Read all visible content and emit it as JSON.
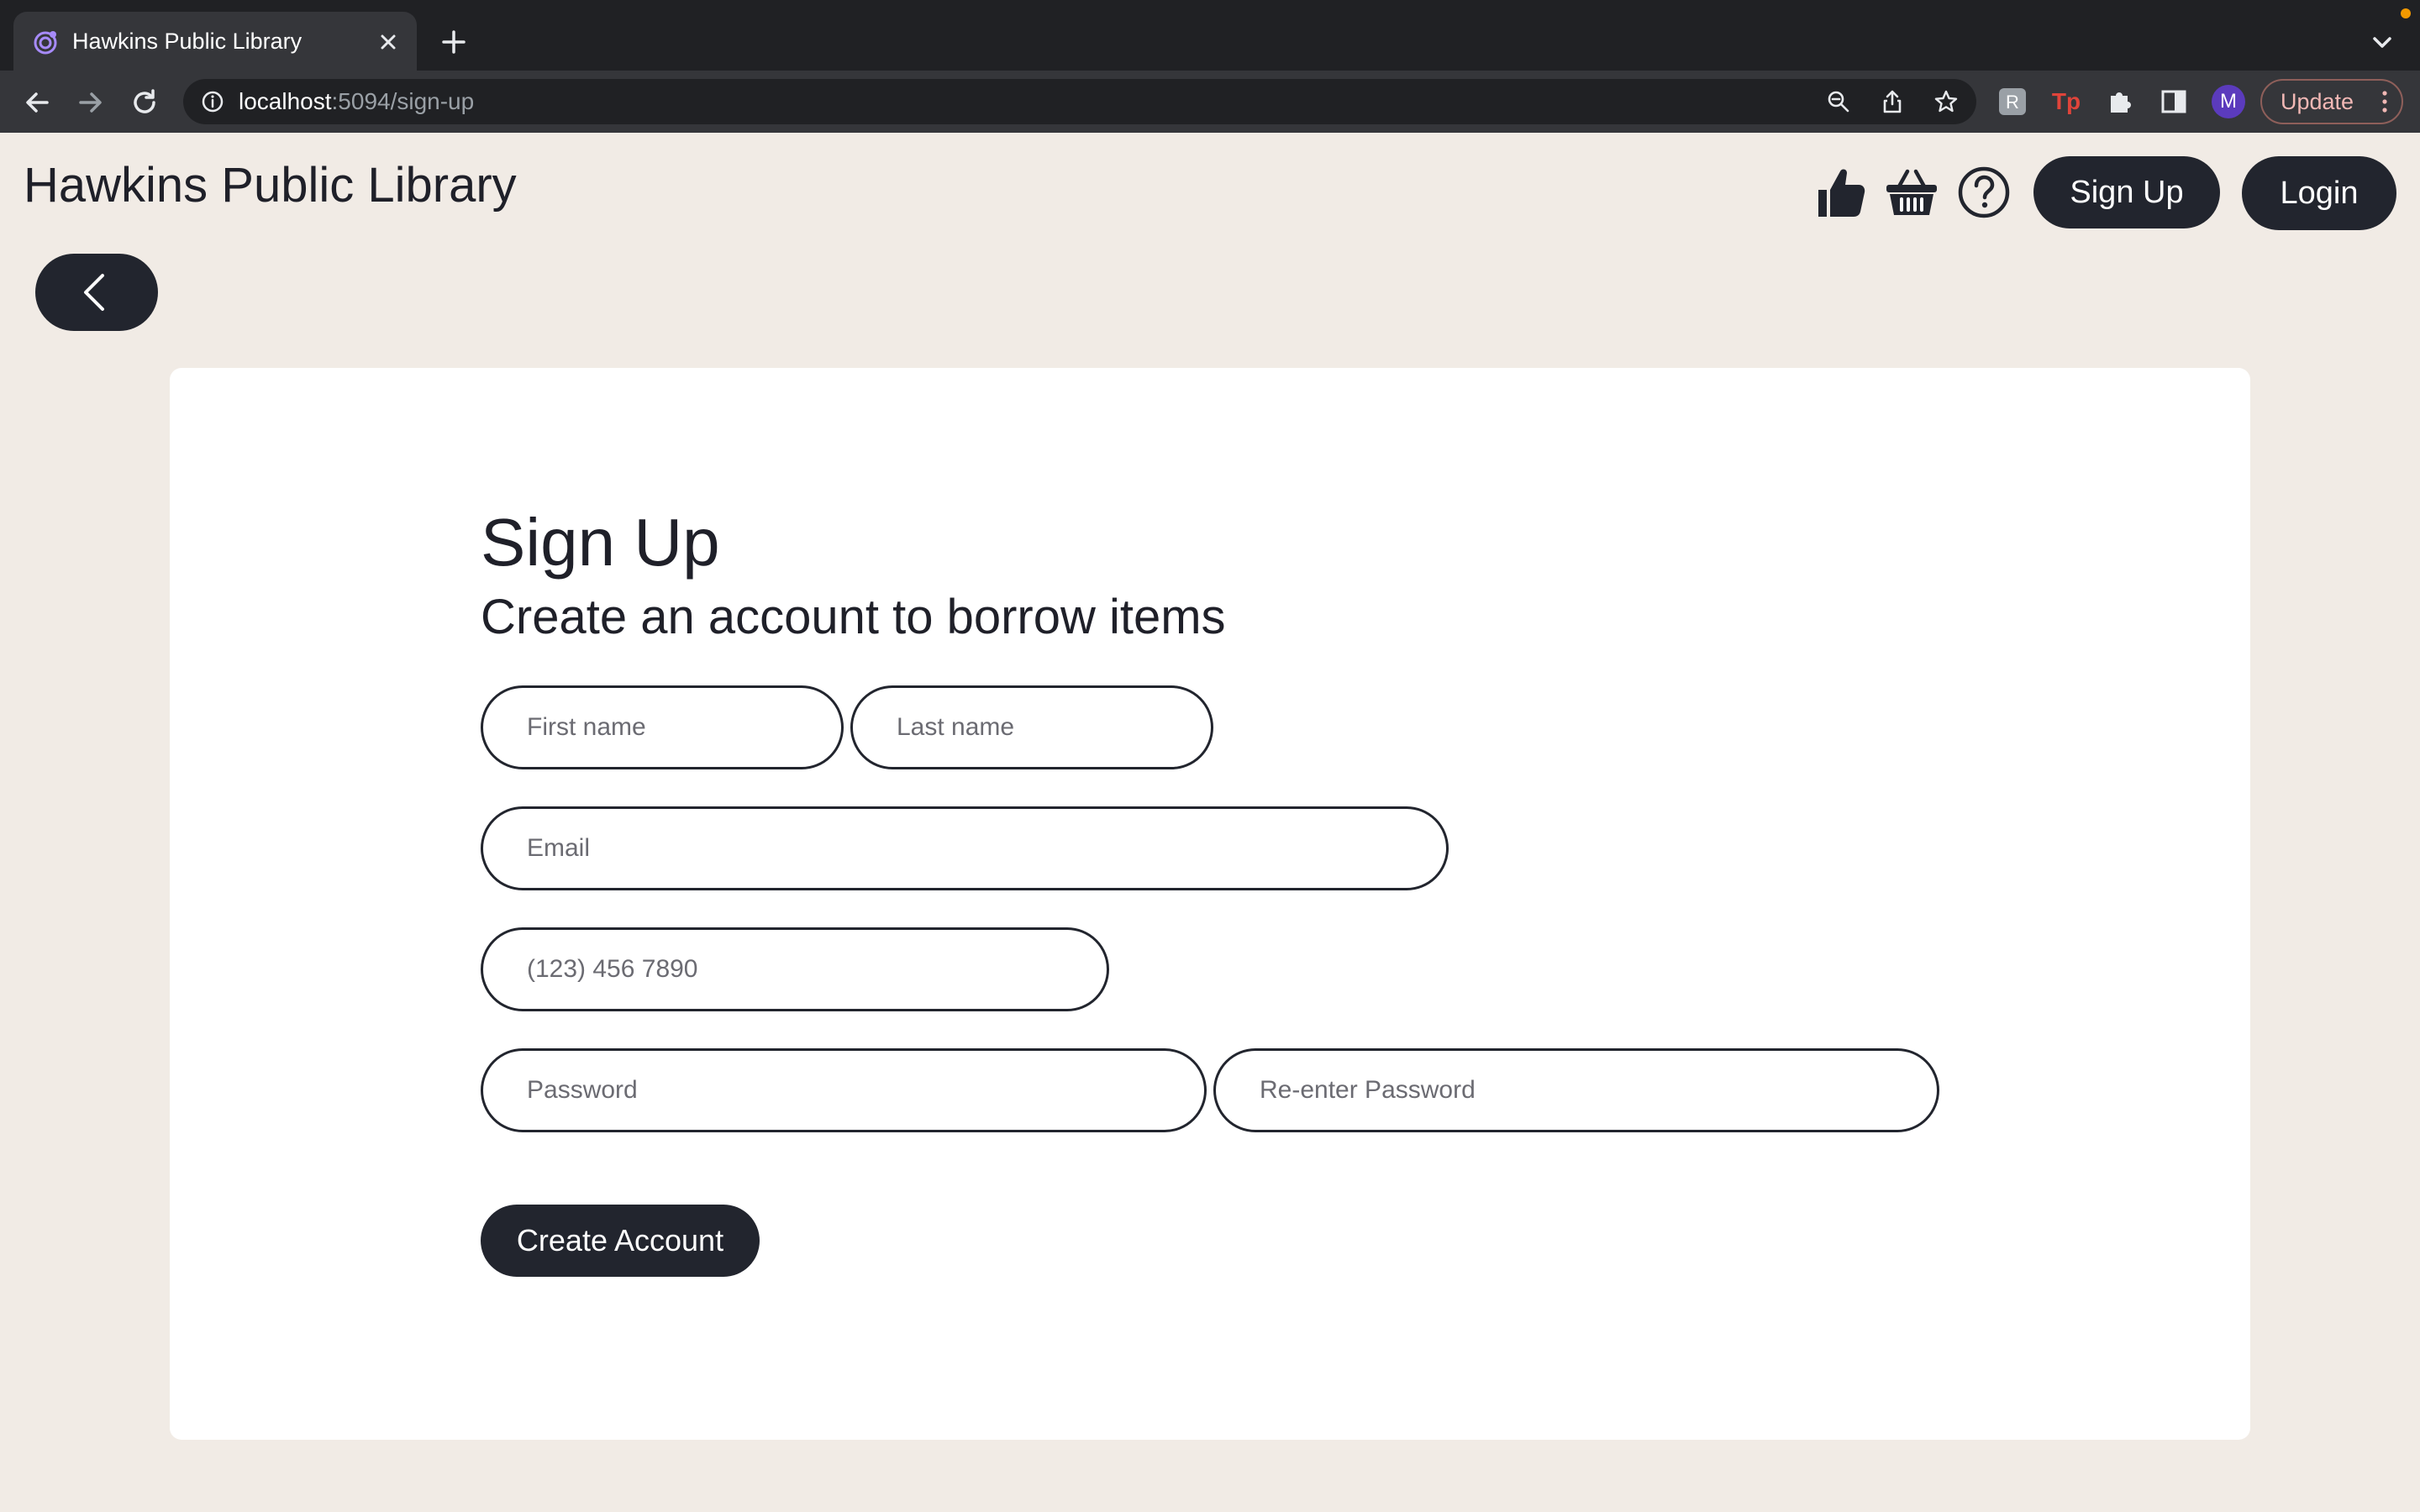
{
  "browser": {
    "tab_title": "Hawkins Public Library",
    "url_host": "localhost",
    "url_rest": ":5094/sign-up",
    "avatar_initial": "M",
    "update_label": "Update"
  },
  "header": {
    "site_title": "Hawkins Public Library",
    "signup_label": "Sign Up",
    "login_label": "Login",
    "icons": [
      "thumbs-up-icon",
      "basket-icon",
      "help-icon"
    ]
  },
  "form": {
    "title": "Sign Up",
    "subtitle": "Create an account to borrow items",
    "first_name_placeholder": "First name",
    "last_name_placeholder": "Last name",
    "email_placeholder": "Email",
    "phone_placeholder": "(123) 456 7890",
    "password_placeholder": "Password",
    "reenter_password_placeholder": "Re-enter Password",
    "submit_label": "Create Account"
  },
  "colors": {
    "page_background": "#f1ebe5",
    "dark_accent": "#22252e",
    "card": "#ffffff"
  }
}
